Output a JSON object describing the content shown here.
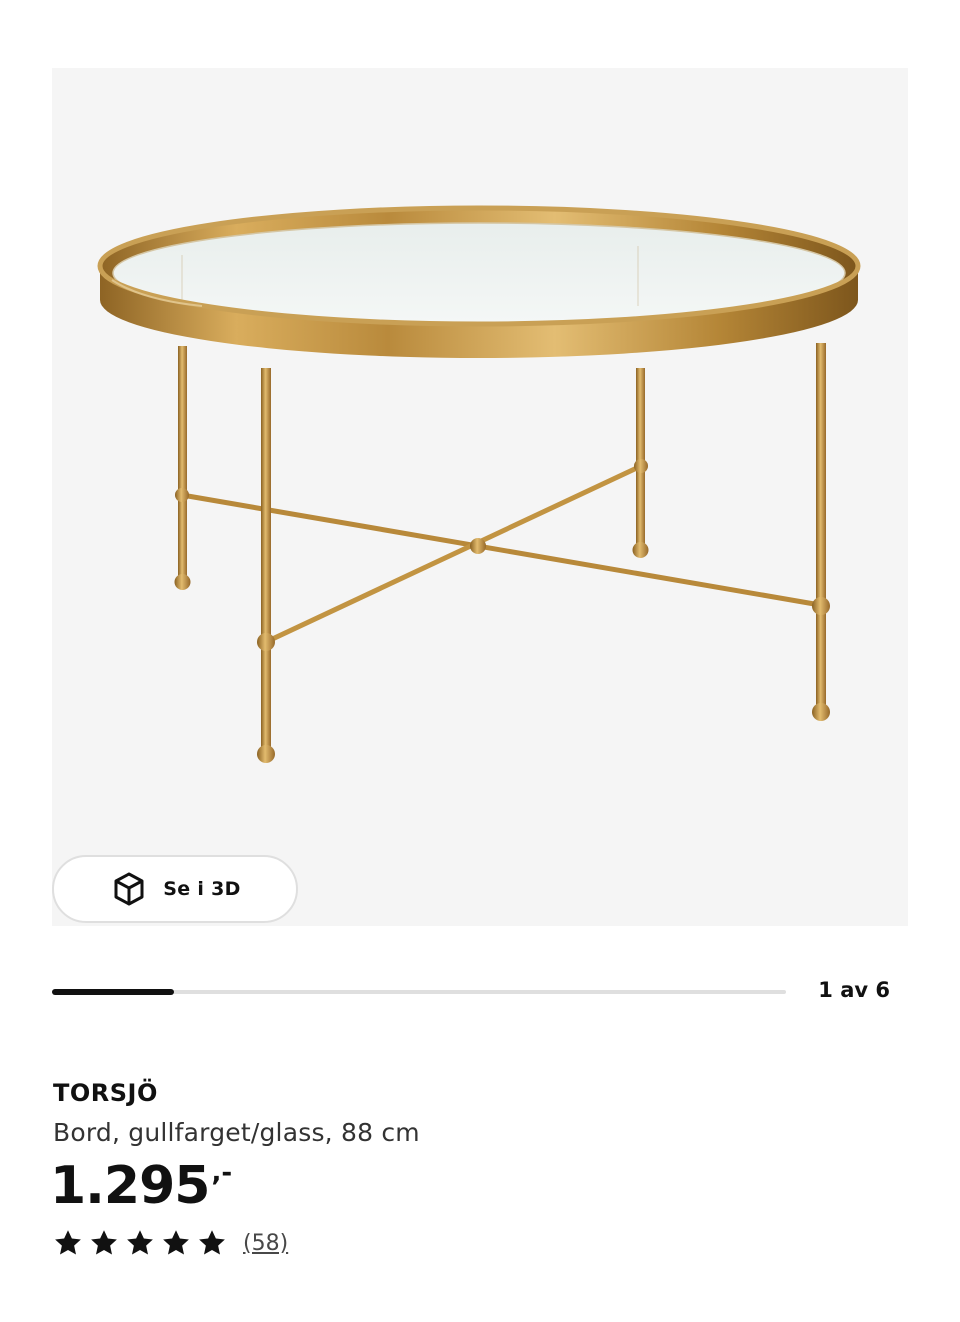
{
  "gallery": {
    "image_alt": "TORSJÖ table, gold-coloured frame with round glass top",
    "view_3d_label": "Se i 3D",
    "view_3d_icon": "cube-3d-icon",
    "slide_counter": "1 av 6",
    "progress_fraction": 0.166
  },
  "product": {
    "name": "TORSJÖ",
    "description": "Bord, gullfarget/glass, 88 cm",
    "price_amount": "1.295",
    "price_suffix": ",-",
    "rating_stars": 5,
    "review_count": "(58)"
  },
  "colors": {
    "gold": "#b8893a",
    "dark": "#111111",
    "track": "#dfdfdf"
  }
}
